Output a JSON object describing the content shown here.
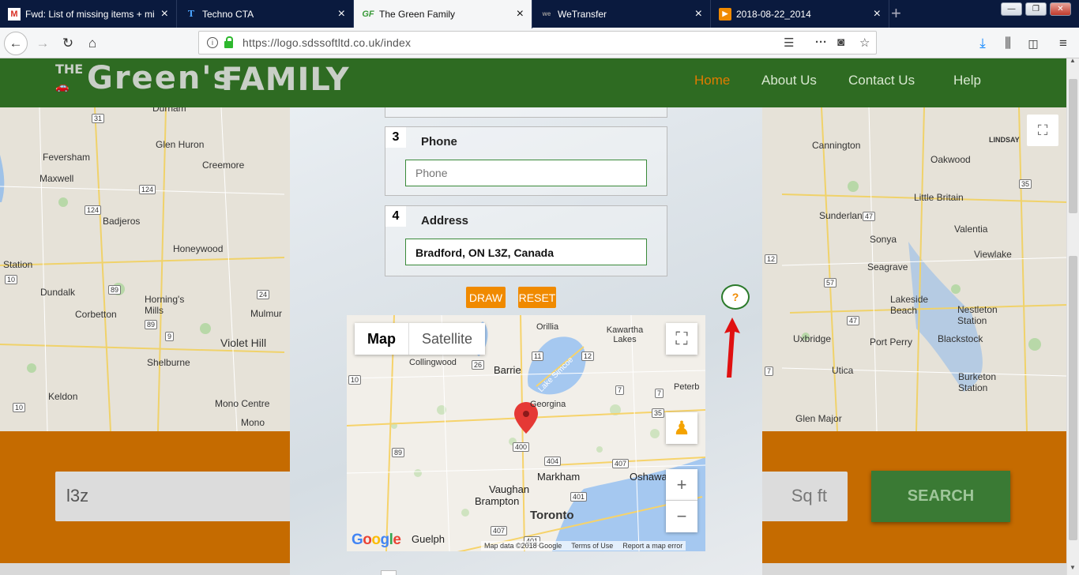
{
  "browser": {
    "tabs": [
      {
        "title": "Fwd: List of missing items + mi",
        "icon": "gmail-icon"
      },
      {
        "title": "Techno CTA",
        "icon": "t-icon"
      },
      {
        "title": "The Green Family",
        "icon": "gf-icon"
      },
      {
        "title": "WeTransfer",
        "icon": "wetransfer-icon"
      },
      {
        "title": "2018-08-22_2014",
        "icon": "play-icon"
      }
    ],
    "url": "https://logo.sdssoftltd.co.uk/index"
  },
  "site": {
    "logo_text_the": "THE",
    "logo_text_greens": "Green's",
    "logo_text_family": "FAMILY",
    "menu": [
      "Home",
      "About Us",
      "Contact Us",
      "Help"
    ]
  },
  "background_map": {
    "places": [
      "Durham",
      "Glen Huron",
      "Feversham",
      "Creemore",
      "Maxwell",
      "Badjeros",
      "Honeywood",
      "Station",
      "Dundalk",
      "Horning's Mills",
      "Corbetton",
      "Mulmur",
      "Violet Hill",
      "Shelburne",
      "Keldon",
      "Mono Centre",
      "Mono",
      "Cannington",
      "Oakwood",
      "Little Britain",
      "LINDSAY",
      "Sunderland",
      "Valentia",
      "Sonya",
      "Viewlake",
      "Seagrave",
      "Lakeside Beach",
      "Nestleton Station",
      "Uxbridge",
      "Port Perry",
      "Blackstock",
      "Utica",
      "Burketon Station",
      "Glen Major"
    ],
    "highways": [
      "31",
      "124",
      "124",
      "10",
      "89",
      "89",
      "24",
      "9",
      "10",
      "35",
      "47",
      "57",
      "47",
      "12",
      "7"
    ]
  },
  "search": {
    "value": "l3z",
    "sqft_placeholder": "Sq ft",
    "button": "SEARCH"
  },
  "modal": {
    "steps": [
      {
        "num": "3",
        "label": "Phone",
        "placeholder": "Phone",
        "value": ""
      },
      {
        "num": "4",
        "label": "Address",
        "placeholder": "",
        "value": "Bradford, ON L3Z, Canada"
      }
    ],
    "draw_label": "DRAW",
    "reset_label": "RESET",
    "help_label": "?"
  },
  "inner_map": {
    "type_buttons": [
      "Map",
      "Satellite"
    ],
    "places": [
      "Orillia",
      "Kawartha Lakes",
      "Collingwood",
      "Barrie",
      "Lake Simcoe",
      "Georgina",
      "Peterb",
      "Markham",
      "Oshawa",
      "Vaughan",
      "Brampton",
      "Toronto",
      "Guelph"
    ],
    "highways": [
      "11",
      "12",
      "26",
      "10",
      "7",
      "7",
      "35",
      "89",
      "400",
      "404",
      "407",
      "401",
      "407",
      "401"
    ],
    "logo": "Google",
    "attribution": [
      "Map data ©2018 Google",
      "Terms of Use",
      "Report a map error"
    ]
  },
  "colors": {
    "header_green": "#2e6b22",
    "accent_orange": "#f08a00",
    "band_orange": "#c56b00"
  }
}
